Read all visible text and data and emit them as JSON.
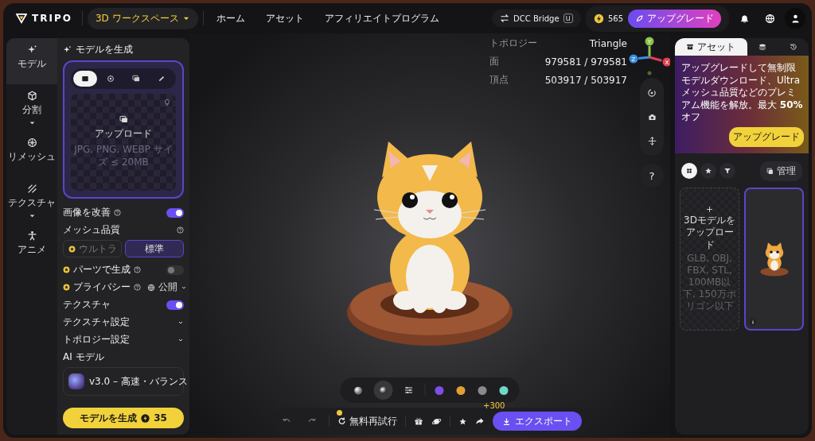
{
  "header": {
    "logo": "TRIPO",
    "workspace": "3D ワークスペース",
    "nav": [
      "ホーム",
      "アセット",
      "アフィリエイトプログラム"
    ],
    "bridge": "DCC Bridge",
    "bridge_badge": "u",
    "credits": "565",
    "upgrade": "アップグレード"
  },
  "rail": [
    {
      "kind": "model",
      "label": "モデル",
      "selected": true,
      "expandable": false
    },
    {
      "kind": "segment",
      "label": "分割",
      "selected": false,
      "expandable": true
    },
    {
      "kind": "remesh",
      "label": "リメッシュ",
      "selected": false,
      "expandable": false
    },
    {
      "kind": "texture",
      "label": "テクスチャ",
      "selected": false,
      "expandable": true
    },
    {
      "kind": "animate",
      "label": "アニメ",
      "selected": false,
      "expandable": false
    }
  ],
  "panel": {
    "title": "モデルを生成",
    "input_tabs": [
      {
        "kind": "image",
        "selected": true
      },
      {
        "kind": "multiview",
        "selected": false
      },
      {
        "kind": "batch",
        "selected": false
      },
      {
        "kind": "sketch",
        "selected": false
      }
    ],
    "upload": {
      "label": "アップロード",
      "hint": "JPG, PNG, WEBP サイズ ≤ 20MB"
    },
    "settings": [
      {
        "kind": "toggle",
        "label": "画像を改善",
        "help": true,
        "premium": false,
        "on": true
      },
      {
        "kind": "heading",
        "label": "メッシュ品質",
        "help": true,
        "premium": false
      },
      {
        "kind": "segments",
        "options": [
          {
            "label": "ウルトラ",
            "premium": true,
            "selected": false
          },
          {
            "label": "標準",
            "premium": false,
            "selected": true
          }
        ]
      },
      {
        "kind": "toggle",
        "label": "パーツで生成",
        "help": true,
        "premium": true,
        "on": false
      },
      {
        "kind": "select",
        "label": "プライバシー",
        "help": true,
        "premium": true,
        "value": "公開"
      },
      {
        "kind": "toggle",
        "label": "テクスチャ",
        "help": false,
        "premium": false,
        "on": true
      },
      {
        "kind": "collapsible",
        "label": "テクスチャ設定",
        "help": false,
        "premium": false
      },
      {
        "kind": "collapsible",
        "label": "トポロジー設定",
        "help": false,
        "premium": false
      },
      {
        "kind": "heading",
        "label": "AI モデル",
        "help": false,
        "premium": false
      },
      {
        "kind": "model",
        "value": "v3.0 – 高速・バランス"
      }
    ],
    "generate": {
      "label": "モデルを生成",
      "cost": "35"
    }
  },
  "viewport": {
    "stats": [
      {
        "label": "トポロジー",
        "value": "Triangle"
      },
      {
        "label": "面",
        "value": "979581 / 979581"
      },
      {
        "label": "頂点",
        "value": "503917 / 503917"
      }
    ],
    "axes": [
      {
        "label": "Y",
        "color": "#8bc34a"
      },
      {
        "label": "X",
        "color": "#e04050"
      },
      {
        "label": "Z",
        "color": "#3a8ee0"
      }
    ],
    "help": "?",
    "render_modes": [
      {
        "selected": false
      },
      {
        "selected": true
      }
    ],
    "swatches": [
      {
        "color": "#7d4fe6"
      },
      {
        "color": "#e0a030"
      },
      {
        "color": "#8a8a8a"
      },
      {
        "color": "#6fd8c8"
      }
    ],
    "retry": "無料再試行",
    "share_bonus": "+300",
    "export": "エクスポート"
  },
  "assets": {
    "tabs": [
      {
        "kind": "assets",
        "label": "アセット",
        "selected": true
      },
      {
        "kind": "layers",
        "selected": false
      },
      {
        "kind": "history",
        "selected": false
      }
    ],
    "promo": {
      "text": "アップグレードして無制限モデルダウンロード、Ultra メッシュ品質などのプレミアム機能を解放。最大 **50%** オフ",
      "button": "アップグレード"
    },
    "filters": [
      {
        "kind": "grid",
        "selected": true
      },
      {
        "kind": "star",
        "selected": false
      },
      {
        "kind": "filter",
        "selected": false
      }
    ],
    "manage": "管理",
    "upload": {
      "title": "3Dモデルをアップロード",
      "hint": "GLB, OBJ, FBX, STL, 100MB以下, 150万ポリゴン以下"
    },
    "models": [
      {
        "selected": true
      }
    ]
  }
}
